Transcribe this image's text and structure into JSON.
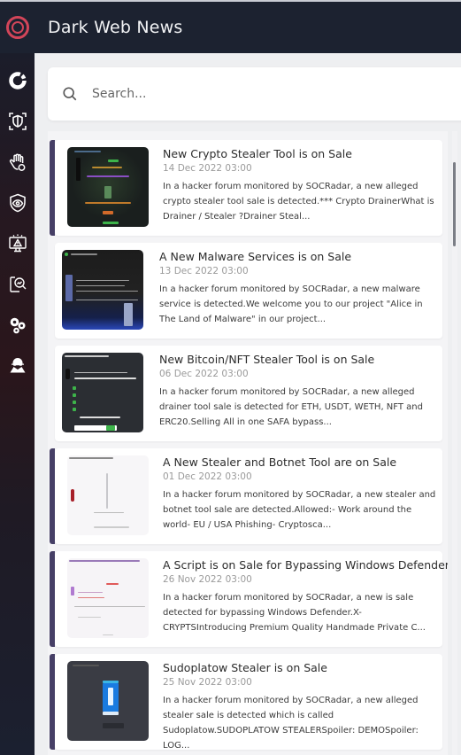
{
  "app": {
    "title": "Dark Web News",
    "logo_icon": "target-ring-logo",
    "accent_color": "#d24559"
  },
  "sidebar": {
    "items": [
      {
        "name": "dashboard",
        "icon": "donut-chart-icon"
      },
      {
        "name": "attack-surface",
        "icon": "shield-scan-icon"
      },
      {
        "name": "threat-hunting",
        "icon": "hand-stop-icon"
      },
      {
        "name": "brand-protection",
        "icon": "shield-eye-icon"
      },
      {
        "name": "incidents",
        "icon": "monitor-alert-icon"
      },
      {
        "name": "reports",
        "icon": "analytics-search-icon"
      },
      {
        "name": "settings",
        "icon": "gears-icon"
      },
      {
        "name": "agents",
        "icon": "hacker-icon"
      }
    ]
  },
  "search": {
    "placeholder": "Search...",
    "value": ""
  },
  "news": [
    {
      "title": "New Crypto Stealer Tool is on Sale",
      "date": "14 Dec 2022 03:00",
      "description": "In a hacker forum monitored by SOCRadar, a new alleged crypto stealer tool sale is detected.*** Crypto DrainerWhat is Drainer / Stealer ?Drainer Steal...",
      "highlighted": true
    },
    {
      "title": "A New Malware Services is on Sale",
      "date": "13 Dec 2022 03:00",
      "description": "In a hacker forum monitored by SOCRadar, a new malware service is detected.We welcome you to our project \"Alice in The Land of Malware\" in our project...",
      "highlighted": false
    },
    {
      "title": "New Bitcoin/NFT Stealer Tool is on Sale",
      "date": "06 Dec 2022 03:00",
      "description": "In a hacker forum monitored by SOCRadar, a new alleged drainer tool sale is detected for ETH, USDT, WETH, NFT and ERC20.Selling All in one SAFA bypass...",
      "highlighted": false
    },
    {
      "title": "A New Stealer and Botnet Tool are on Sale",
      "date": "01 Dec 2022 03:00",
      "description": "In a hacker forum monitored by SOCRadar, a new stealer and botnet tool sale are detected.Allowed:- Work around the world- EU / USA Phishing- Cryptosca...",
      "highlighted": true
    },
    {
      "title": "A Script is on Sale for Bypassing Windows Defender",
      "date": "26 Nov 2022 03:00",
      "description": "In a hacker forum monitored by SOCRadar, a new is sale detected for bypassing Windows Defender.X-CRYPTSIntroducing Premium Quality Handmade Private C...",
      "highlighted": true
    },
    {
      "title": "Sudoplatow Stealer is on Sale",
      "date": "25 Nov 2022 03:00",
      "description": "In a hacker forum monitored by SOCRadar, a new alleged stealer sale is detected which is called Sudoplatow.SUDOPLATOW STEALERSpoiler: DEMOSpoiler: LOG...",
      "highlighted": true
    }
  ],
  "colors": {
    "topbar": "#1c2230",
    "highlight_bar": "#463f66",
    "date_text": "#9a9a9a"
  }
}
